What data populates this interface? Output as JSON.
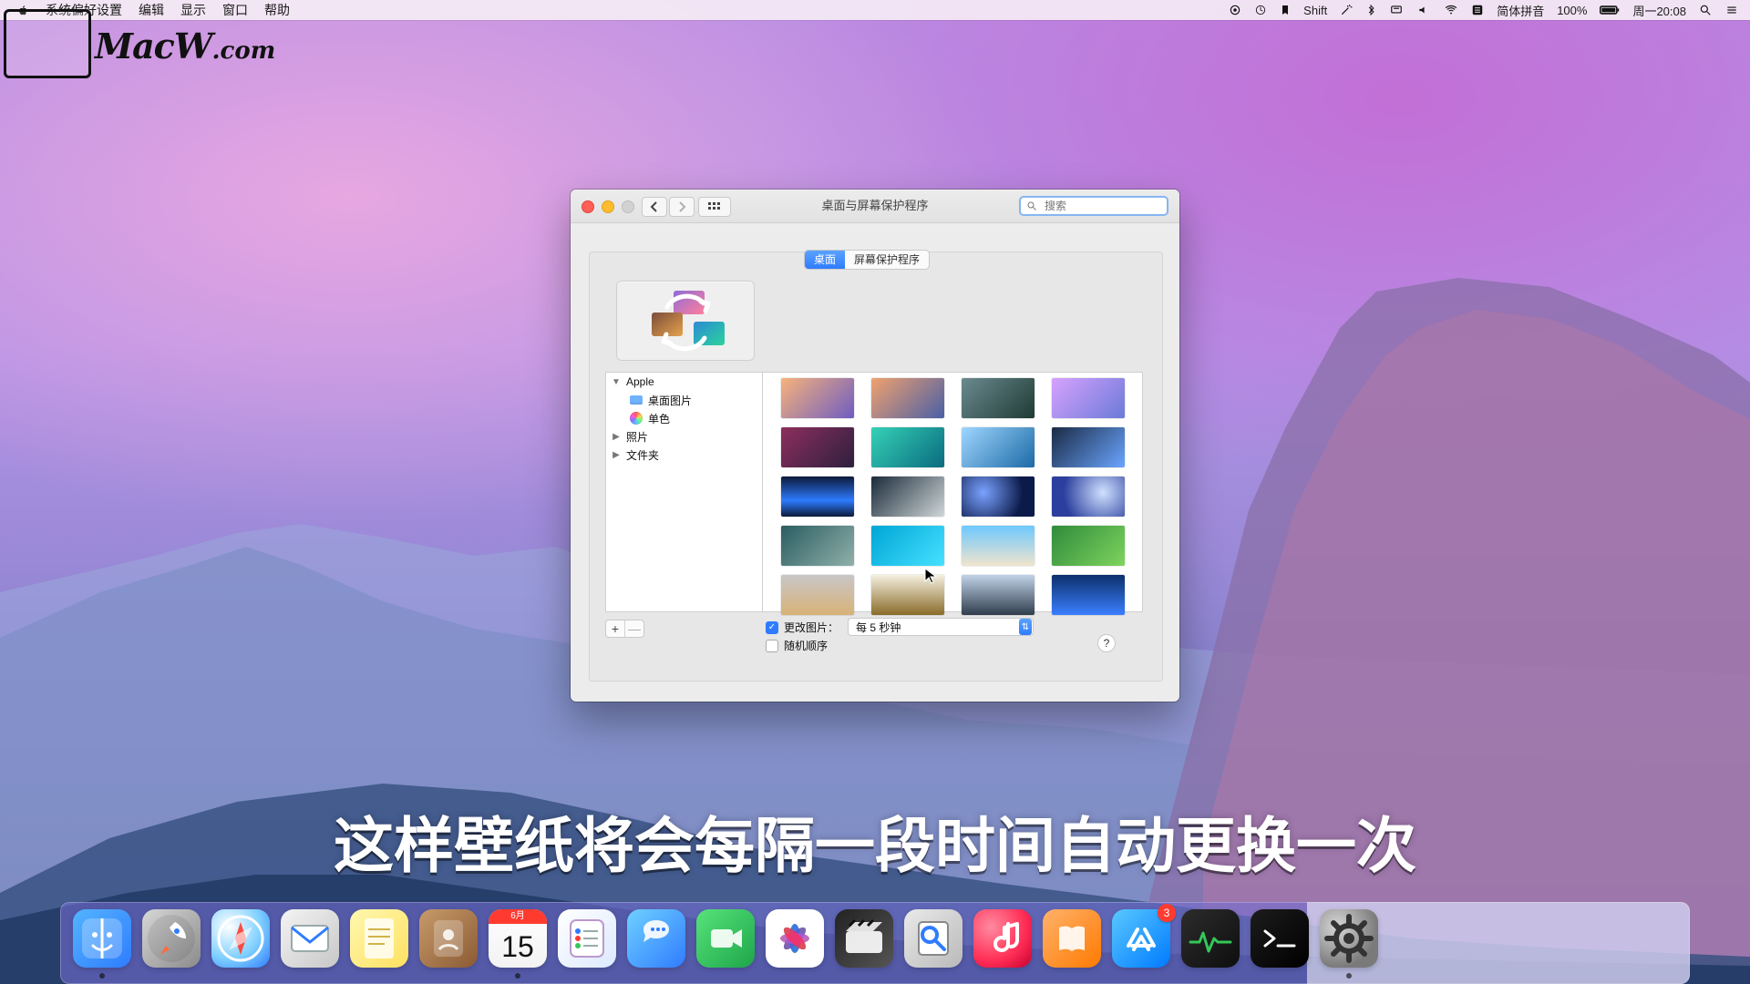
{
  "menubar": {
    "apple_icon": "apple-icon",
    "app_name": "系统偏好设置",
    "menus": [
      "编辑",
      "显示",
      "窗口",
      "帮助"
    ],
    "right": {
      "shift": "Shift",
      "input_method": "简体拼音",
      "battery": "100%",
      "clock": "周一20:08",
      "icons": [
        "record-icon",
        "pin-icon",
        "bookmark-icon",
        "magic-icon",
        "bluetooth-icon",
        "display-icon",
        "volume-icon",
        "wifi-icon",
        "input-grid-icon",
        "battery-icon",
        "search-icon",
        "menu-icon"
      ]
    }
  },
  "logo": {
    "text_main": "MacW",
    "text_suffix": ".com"
  },
  "window": {
    "title": "桌面与屏幕保护程序",
    "search_placeholder": "搜索",
    "tabs": {
      "desktop": "桌面",
      "screensaver": "屏幕保护程序"
    },
    "sidebar": {
      "apple": "Apple",
      "desktop_pictures": "桌面图片",
      "solid_colors": "单色",
      "photos": "照片",
      "folders": "文件夹"
    },
    "controls": {
      "change_picture_label": "更改图片：",
      "interval": "每 5 秒钟",
      "random_order": "随机顺序",
      "help": "?"
    },
    "buttons": {
      "add": "+",
      "remove": "—"
    }
  },
  "subtitle": "这样壁纸将会每隔一段时间自动更换一次",
  "dock": {
    "items": [
      {
        "name": "Finder",
        "icon": "finder-icon",
        "badge": ""
      },
      {
        "name": "Launchpad",
        "icon": "rocket-icon",
        "badge": ""
      },
      {
        "name": "Safari",
        "icon": "safari-icon",
        "badge": ""
      },
      {
        "name": "Mail",
        "icon": "mail-icon",
        "badge": ""
      },
      {
        "name": "Notes",
        "icon": "notes-icon",
        "badge": ""
      },
      {
        "name": "Contacts",
        "icon": "contacts-icon",
        "badge": ""
      },
      {
        "name": "Calendar",
        "icon": "calendar-icon",
        "badge": "",
        "month": "6月",
        "day": "15"
      },
      {
        "name": "Reminders",
        "icon": "reminders-icon",
        "badge": ""
      },
      {
        "name": "Messages",
        "icon": "messages-icon",
        "badge": ""
      },
      {
        "name": "FaceTime",
        "icon": "facetime-icon",
        "badge": ""
      },
      {
        "name": "Photos",
        "icon": "photos-icon",
        "badge": ""
      },
      {
        "name": "Final Cut Pro",
        "icon": "finalcut-icon",
        "badge": ""
      },
      {
        "name": "Preview",
        "icon": "preview-icon",
        "badge": ""
      },
      {
        "name": "Music",
        "icon": "music-icon",
        "badge": ""
      },
      {
        "name": "iBooks",
        "icon": "books-icon",
        "badge": ""
      },
      {
        "name": "App Store",
        "icon": "appstore-icon",
        "badge": "3"
      },
      {
        "name": "Activity Monitor",
        "icon": "activity-icon",
        "badge": ""
      },
      {
        "name": "Terminal",
        "icon": "terminal-icon",
        "badge": ""
      },
      {
        "name": "System Preferences",
        "icon": "gear-icon",
        "badge": ""
      }
    ]
  },
  "colors": {
    "accent_blue": "#2f7cff",
    "close": "#ff5f57",
    "minimize": "#febc2e",
    "maximize": "#d2d2d2",
    "badge_red": "#ff3b30"
  }
}
